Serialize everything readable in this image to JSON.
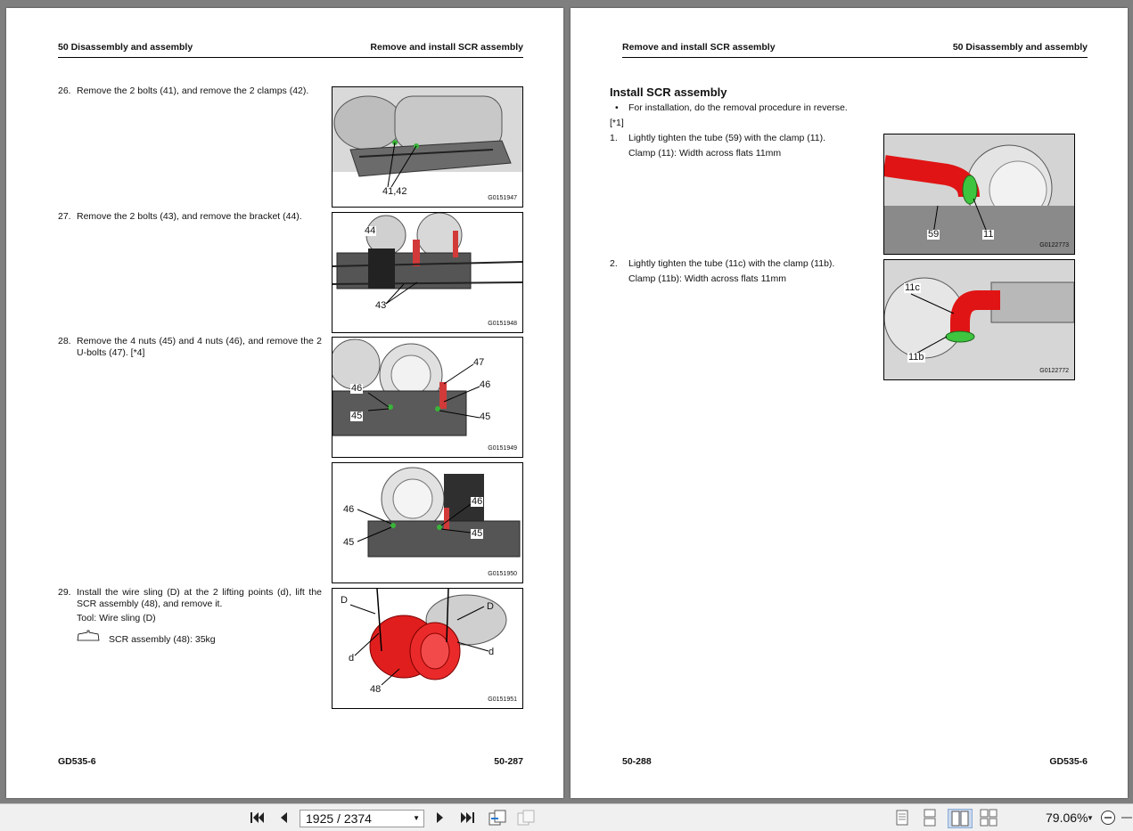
{
  "left_page": {
    "header_left": "50 Disassembly and assembly",
    "header_right": "Remove and install SCR assembly",
    "footer_left": "GD535-6",
    "footer_right": "50-287",
    "steps": [
      {
        "num": "26.",
        "text": "Remove the 2 bolts (41), and remove the 2 clamps (42)."
      },
      {
        "num": "27.",
        "text": "Remove the 2 bolts (43), and remove the bracket (44)."
      },
      {
        "num": "28.",
        "text": "Remove the 4 nuts (45) and 4 nuts (46), and remove the 2 U-bolts (47). [*4]"
      },
      {
        "num": "29.",
        "text": "Install the wire sling (D) at the 2 lifting points (d), lift the SCR assembly (48), and remove it.",
        "tool": "Tool: Wire sling (D)",
        "weight": "SCR assembly (48): 35kg"
      }
    ],
    "figures": [
      {
        "code": "G0151947",
        "labels": [
          "41,42"
        ]
      },
      {
        "code": "G0151948",
        "labels": [
          "44",
          "43"
        ]
      },
      {
        "code": "G0151949",
        "labels": [
          "47",
          "46",
          "46",
          "45",
          "45"
        ]
      },
      {
        "code": "G0151950",
        "labels": [
          "46",
          "46",
          "45",
          "45"
        ]
      },
      {
        "code": "G0151951",
        "labels": [
          "D",
          "D",
          "d",
          "d",
          "48"
        ]
      }
    ]
  },
  "right_page": {
    "header_left": "Remove and install SCR assembly",
    "header_right": "50 Disassembly and assembly",
    "footer_left": "50-288",
    "footer_right": "GD535-6",
    "section_title": "Install SCR assembly",
    "bullet": "For installation, do the removal procedure in reverse.",
    "ref": "[*1]",
    "steps": [
      {
        "num": "1.",
        "text": "Lightly tighten the tube (59) with the clamp (11).",
        "sub": "Clamp (11): Width across flats 11mm"
      },
      {
        "num": "2.",
        "text": "Lightly tighten the tube (11c) with the clamp (11b).",
        "sub": "Clamp (11b): Width across flats 11mm"
      }
    ],
    "figures": [
      {
        "code": "G0122773",
        "labels": [
          "59",
          "11"
        ]
      },
      {
        "code": "G0122772",
        "labels": [
          "11c",
          "11b"
        ]
      }
    ]
  },
  "toolbar": {
    "page_indicator": "1925 / 2374",
    "zoom": "79.06%",
    "icons": [
      "first-page-icon",
      "prev-page-icon",
      "next-page-icon",
      "last-page-icon",
      "prev-view-icon",
      "next-view-icon",
      "single-page-icon",
      "continuous-icon",
      "facing-icon",
      "facing-continuous-icon",
      "zoom-out-icon"
    ]
  }
}
